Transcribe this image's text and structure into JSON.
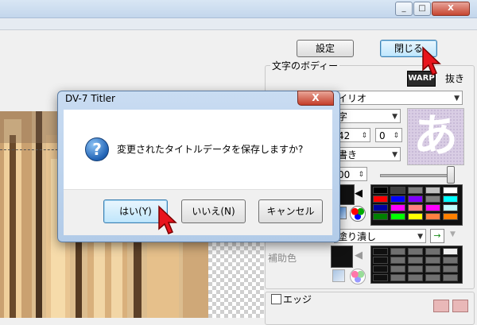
{
  "window": {
    "minimize": "_",
    "maximize": "□",
    "close": "X"
  },
  "panel": {
    "settings_button": "設定",
    "close_button": "閉じる",
    "body_group_title": "文字のボディー",
    "warp_label": "WARP",
    "cutout_label": "抜き",
    "font_value": "イリオ",
    "style_value": "字",
    "size_value": "42",
    "spacing_value": "0",
    "direction_value": "書き",
    "opacity_value": "00",
    "preview_glyph": "あ",
    "fill_value": "塗り潰し",
    "aux_color_label": "補助色",
    "edge_label": "エッジ"
  },
  "dialog": {
    "title": "DV-7 Titler",
    "close": "X",
    "message": "変更されたタイトルデータを保存しますか?",
    "icon": "?",
    "yes_button": "はい(Y)",
    "no_button": "いいえ(N)",
    "cancel_button": "キャンセル"
  },
  "colors": {
    "palette_row1": [
      "#000000",
      "#404040",
      "#808080",
      "#c0c0c0",
      "#ffffff"
    ],
    "palette_row2": [
      "#ff0000",
      "#0000ff",
      "#8000ff",
      "#808080",
      "#00ffff"
    ],
    "palette_row3": [
      "#0000a0",
      "#ff00ff",
      "#ff8080",
      "#ff00ff",
      "#c0ffff"
    ],
    "palette_row4": [
      "#008000",
      "#00ff00",
      "#ffff00",
      "#ff8040",
      "#ff8000"
    ],
    "accent_red": "#e8141d"
  }
}
